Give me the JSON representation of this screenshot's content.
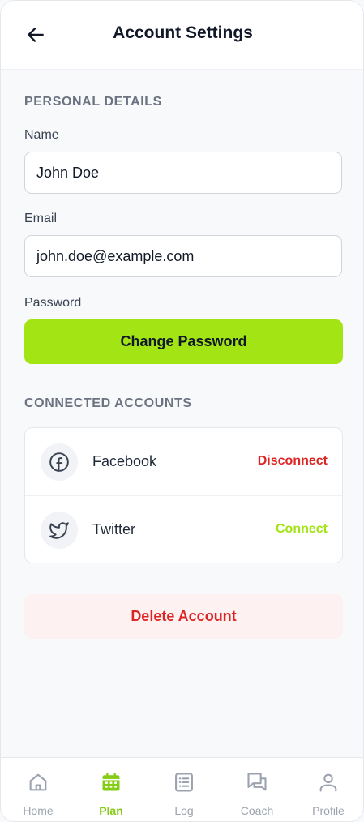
{
  "header": {
    "title": "Account Settings",
    "back_icon": "arrow-left-icon"
  },
  "personal": {
    "section_title": "PERSONAL DETAILS",
    "name_label": "Name",
    "name_value": "John Doe",
    "email_label": "Email",
    "email_value": "john.doe@example.com",
    "password_label": "Password",
    "change_password_label": "Change Password"
  },
  "connected": {
    "section_title": "CONNECTED ACCOUNTS",
    "accounts": [
      {
        "name": "Facebook",
        "icon": "facebook-icon",
        "action": "Disconnect",
        "action_color": "#dc2626"
      },
      {
        "name": "Twitter",
        "icon": "twitter-icon",
        "action": "Connect",
        "action_color": "#a3e414"
      }
    ]
  },
  "danger": {
    "delete_label": "Delete Account"
  },
  "nav": {
    "items": [
      {
        "label": "Home",
        "icon": "home-icon",
        "active": false
      },
      {
        "label": "Plan",
        "icon": "calendar-icon",
        "active": true
      },
      {
        "label": "Log",
        "icon": "list-icon",
        "active": false
      },
      {
        "label": "Coach",
        "icon": "chat-icon",
        "active": false
      },
      {
        "label": "Profile",
        "icon": "user-icon",
        "active": false
      }
    ]
  },
  "colors": {
    "accent": "#a3e414",
    "danger": "#dc2626",
    "danger_bg": "#fef1f1"
  }
}
